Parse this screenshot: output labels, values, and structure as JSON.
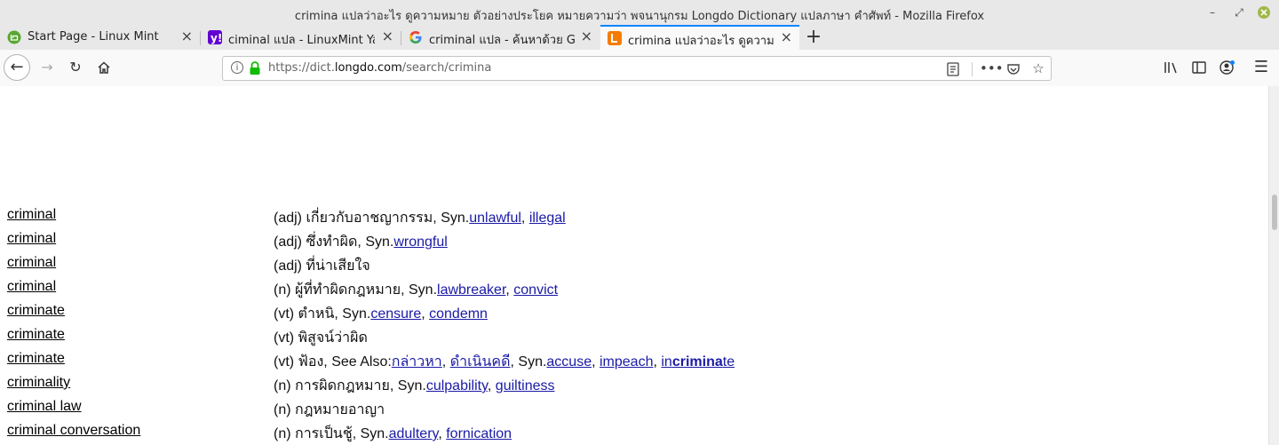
{
  "window": {
    "title": "crimina แปลว่าอะไร ดูความหมาย ตัวอย่างประโยค หมายความว่า พจนานุกรม Longdo Dictionary แปลภาษา คำศัพท์ - Mozilla Firefox"
  },
  "tabs": [
    {
      "label": "Start Page - Linux Mint",
      "color": "#5aa632"
    },
    {
      "label": "ciminal แปล - LinuxMint Yahoo",
      "color": "#6001d2"
    },
    {
      "label": "criminal แปล - ค้นหาด้วย Google",
      "color": "#4285f4"
    },
    {
      "label": "crimina แปลว่าอะไร ดูความหมาย",
      "color": "#f57c00"
    }
  ],
  "nav": {
    "url_prefix": "https://dict.",
    "url_domain": "longdo.com",
    "url_path": "/search/crimina"
  },
  "entries": [
    {
      "term_bold": "crimina",
      "term_rest": "l",
      "pos_def": "(adj) เกี่ยวกับอาชญากรรม, Syn.",
      "links": [
        "unlawful",
        "illegal"
      ]
    },
    {
      "term_bold": "crimina",
      "term_rest": "l",
      "pos_def": "(adj) ซึ่งทำผิด, Syn.",
      "links": [
        "wrongful"
      ]
    },
    {
      "term_bold": "crimina",
      "term_rest": "l",
      "pos_def": "(adj) ที่น่าเสียใจ",
      "links": []
    },
    {
      "term_bold": "crimina",
      "term_rest": "l",
      "pos_def": "(n) ผู้ที่ทำผิดกฎหมาย, Syn.",
      "links": [
        "lawbreaker",
        "convict"
      ]
    },
    {
      "term_bold": "crimina",
      "term_rest": "te",
      "pos_def": "(vt) ตำหนิ, Syn.",
      "links": [
        "censure",
        "condemn"
      ]
    },
    {
      "term_bold": "crimina",
      "term_rest": "te",
      "pos_def": "(vt) พิสูจน์ว่าผิด",
      "links": []
    },
    {
      "term_bold": "crimina",
      "term_rest": "te",
      "pos_def": "(vt) ฟ้อง, See Also:",
      "links": [
        "กล่าวหา",
        "ดำเนินคดี"
      ],
      "mid": ", Syn.",
      "links2": [
        "accuse",
        "impeach"
      ],
      "last_pre": "in",
      "last_bold": "crimina",
      "last_post": "te"
    },
    {
      "term_bold": "crimina",
      "term_rest": "lity",
      "pos_def": "(n) การผิดกฎหมาย, Syn.",
      "links": [
        "culpability",
        "guiltiness"
      ]
    },
    {
      "term_bold": "crimina",
      "term_rest": "l law",
      "pos_def": "(n) กฎหมายอาญา",
      "links": []
    },
    {
      "term_bold": "crimina",
      "term_rest": "l conversation",
      "pos_def": "(n) การเป็นชู้, Syn.",
      "links": [
        "adultery",
        "fornication"
      ]
    }
  ]
}
